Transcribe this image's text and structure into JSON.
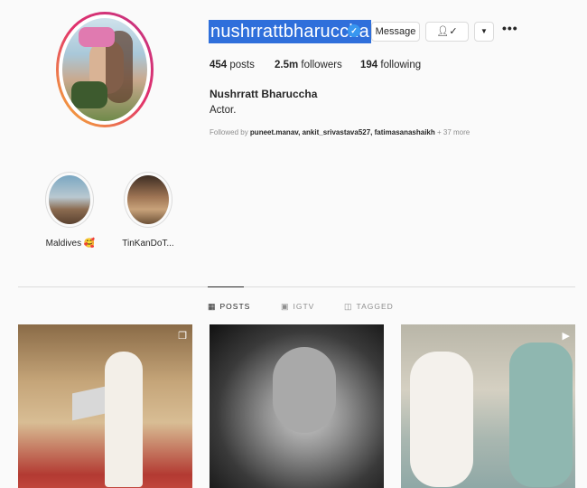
{
  "profile": {
    "username": "nushrrattbharuccha",
    "verified_icon": "verified-badge-icon",
    "buttons": {
      "message": "Message",
      "follow_icon": "person-check-icon",
      "dropdown_icon": "caret-down-icon",
      "more": "•••"
    },
    "stats": {
      "posts_count": "454",
      "posts_label": "posts",
      "followers_count": "2.5m",
      "followers_label": "followers",
      "following_count": "194",
      "following_label": "following"
    },
    "full_name": "Nushrratt Bharuccha",
    "bio": "Actor.",
    "followed_by": {
      "prefix": "Followed by",
      "users": "puneet.manav, ankit_srivastava527, fatimasanashaikh",
      "suffix": "+ 37 more"
    }
  },
  "highlights": [
    {
      "label": "Maldives 🥰"
    },
    {
      "label": "TinKanDoT..."
    }
  ],
  "tabs": [
    {
      "label": "POSTS",
      "icon": "grid-icon",
      "active": true
    },
    {
      "label": "IGTV",
      "icon": "igtv-icon",
      "active": false
    },
    {
      "label": "TAGGED",
      "icon": "tagged-icon",
      "active": false
    }
  ],
  "posts": [
    {
      "type_icon": "carousel-icon"
    },
    {
      "type_icon": ""
    },
    {
      "type_icon": "video-icon"
    }
  ],
  "colors": {
    "selection": "#2f6fdb",
    "verified": "#3897f0",
    "avatar_ring_start": "#f7b731",
    "avatar_ring_end": "#c13584"
  }
}
